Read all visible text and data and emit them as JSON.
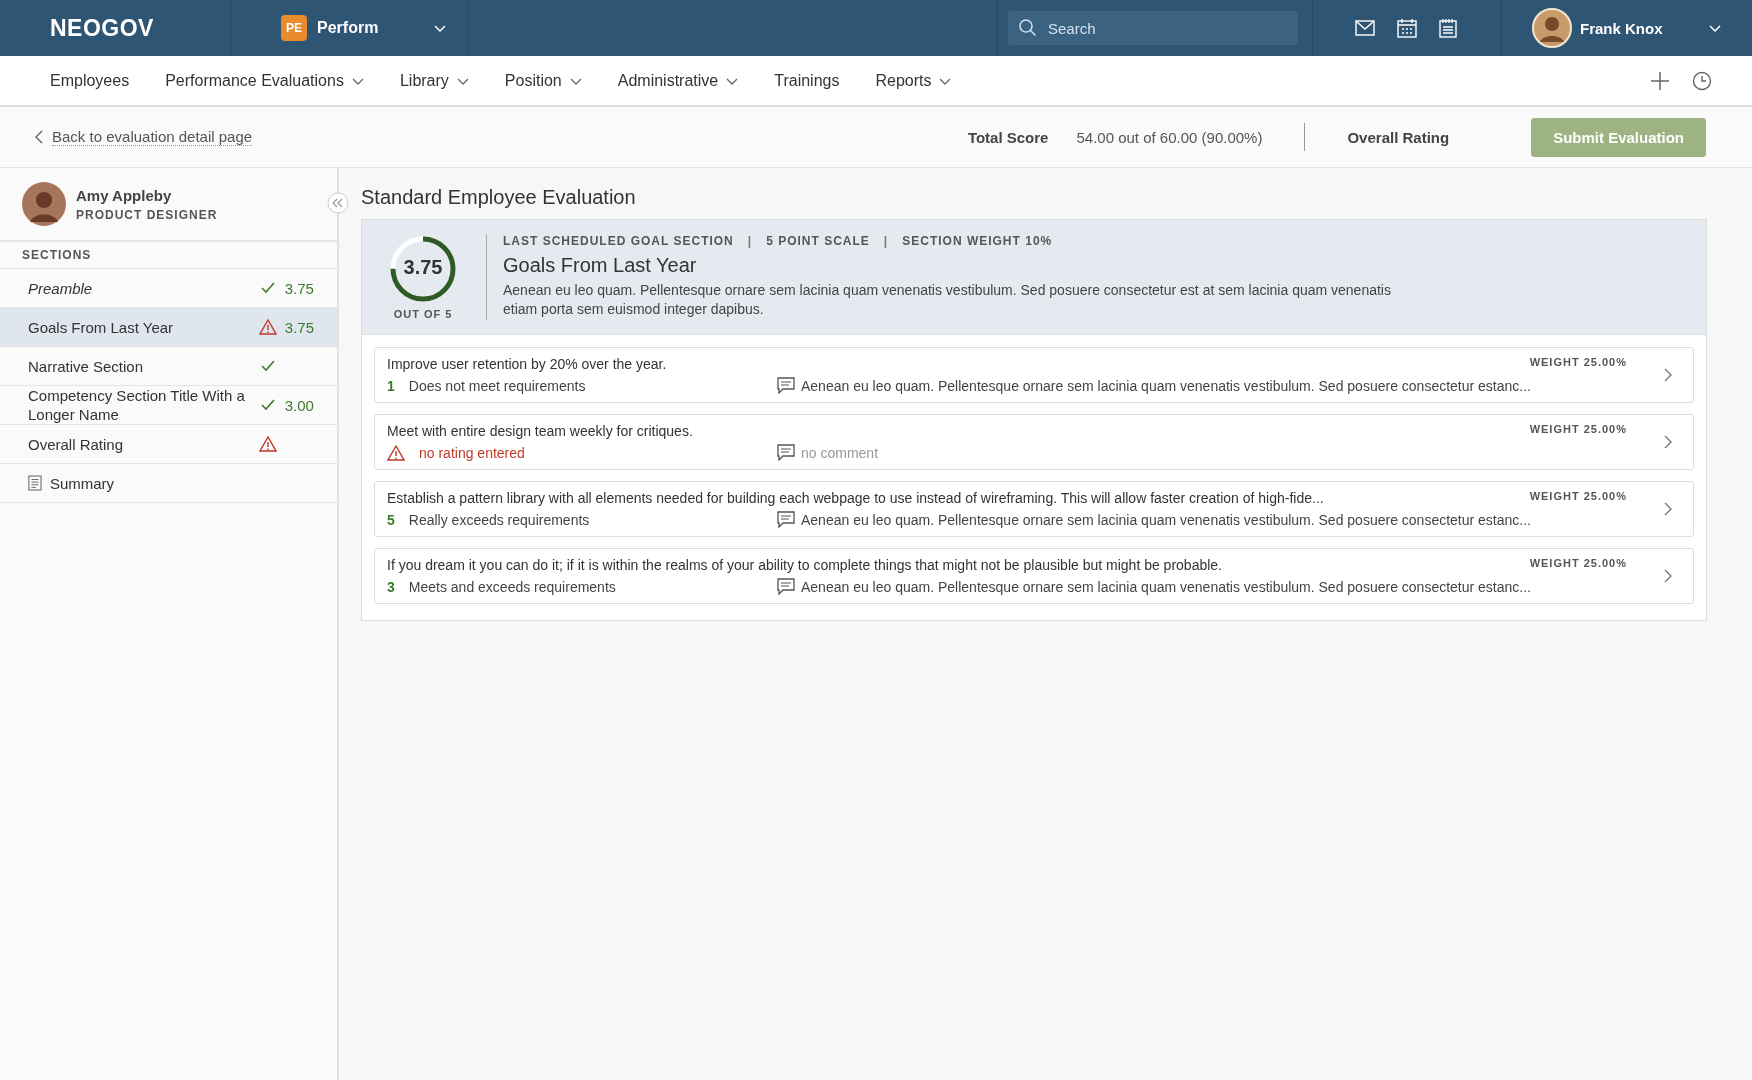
{
  "topbar": {
    "logo": "NEOGOV",
    "app": {
      "badge": "PE",
      "name": "Perform"
    },
    "search": {
      "placeholder": "Search"
    },
    "user": {
      "name": "Frank Knox"
    }
  },
  "nav": {
    "items": [
      {
        "label": "Employees",
        "dropdown": false
      },
      {
        "label": "Performance Evaluations",
        "dropdown": true
      },
      {
        "label": "Library",
        "dropdown": true
      },
      {
        "label": "Position",
        "dropdown": true
      },
      {
        "label": "Administrative",
        "dropdown": true
      },
      {
        "label": "Trainings",
        "dropdown": false
      },
      {
        "label": "Reports",
        "dropdown": true
      }
    ]
  },
  "subheader": {
    "back_link": "Back to evaluation detail page",
    "total_score_label": "Total Score",
    "total_score": "54.00 out of 60.00 (90.00%)",
    "overall_rating_label": "Overall Rating",
    "submit_button": "Submit Evaluation"
  },
  "sidebar": {
    "employee": {
      "name": "Amy Appleby",
      "title": "PRODUCT DESIGNER"
    },
    "sections_heading": "SECTIONS",
    "items": [
      {
        "kind": "preamble",
        "label": "Preamble",
        "complete": true,
        "warning": false,
        "score": "3.75",
        "selected": false
      },
      {
        "kind": "section",
        "label": "Goals From Last Year",
        "complete": false,
        "warning": true,
        "score": "3.75",
        "selected": true
      },
      {
        "kind": "section",
        "label": "Narrative Section",
        "complete": true,
        "warning": false,
        "selected": false
      },
      {
        "kind": "section",
        "label": "Competency Section Title With a Longer Name",
        "complete": true,
        "warning": false,
        "score": "3.00",
        "selected": false
      },
      {
        "kind": "section",
        "label": "Overall Rating",
        "complete": false,
        "warning": true,
        "selected": false
      },
      {
        "kind": "summary",
        "label": "Summary",
        "complete": false,
        "warning": false,
        "selected": false
      }
    ]
  },
  "main": {
    "title": "Standard Employee Evaluation",
    "section": {
      "score": "3.75",
      "level": 0.75,
      "score_caption": "OUT OF 5",
      "meta": [
        "LAST SCHEDULED GOAL SECTION",
        "5 POINT SCALE",
        "SECTION WEIGHT 10%"
      ],
      "separator": "|",
      "name": "Goals From Last Year",
      "description": "Aenean eu leo quam. Pellentesque ornare sem lacinia quam venenatis vestibulum. Sed posuere consectetur est at sem lacinia quam venenatis etiam porta sem euismod integer dapibus."
    },
    "goals": [
      {
        "kind": "rated",
        "title": "Improve user retention by 20% over the year.",
        "rating": "1",
        "rating_label": "Does not meet requirements",
        "comment": "Aenean eu leo quam. Pellentesque ornare sem lacinia quam venenatis vestibulum. Sed posuere consectetur estanc...",
        "weight": "WEIGHT 25.00%"
      },
      {
        "kind": "unrated",
        "title": "Meet with entire design team weekly for critiques.",
        "rating_label": "no rating entered",
        "comment": "no comment",
        "weight": "WEIGHT 25.00%"
      },
      {
        "kind": "rated",
        "title": "Establish a pattern library with all elements needed for building each webpage to use instead of wireframing. This will allow faster creation of high-fide...",
        "rating": "5",
        "rating_label": "Really exceeds requirements",
        "comment": "Aenean eu leo quam. Pellentesque ornare sem lacinia quam venenatis vestibulum. Sed posuere consectetur estanc...",
        "weight": "WEIGHT 25.00%"
      },
      {
        "kind": "rated",
        "title": "If you dream it you can do it; if it is within the realms of your ability to complete things that might not be plausible but might be probable.",
        "rating": "3",
        "rating_label": "Meets and exceeds requirements",
        "comment": "Aenean eu leo quam. Pellentesque ornare sem lacinia quam venenatis vestibulum. Sed posuere consectetur estanc...",
        "weight": "WEIGHT 25.00%"
      }
    ]
  }
}
